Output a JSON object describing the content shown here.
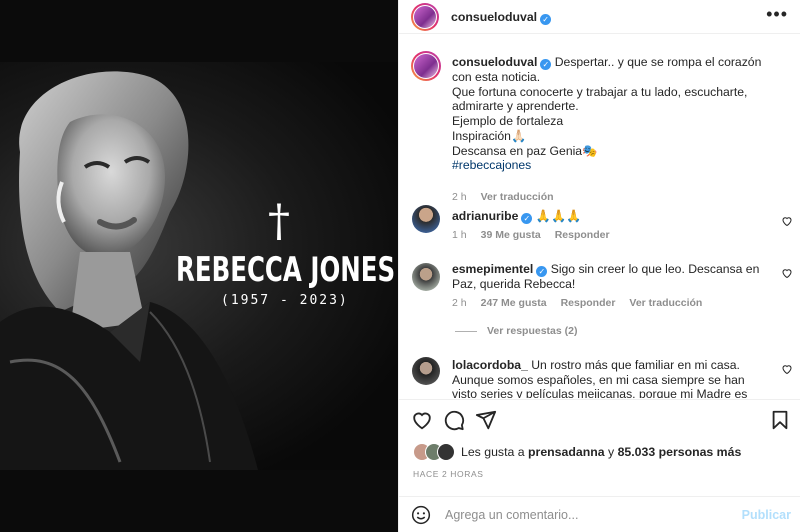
{
  "image": {
    "cross": "†",
    "title": "REBECCA JONES",
    "years": "(1957 - 2023)"
  },
  "header": {
    "username": "consueloduval",
    "verified": "✓",
    "menu": "•••"
  },
  "caption": {
    "username": "consueloduval",
    "verified": "✓",
    "text": "Despertar.. y que se rompa el corazón con esta noticia.",
    "lines": [
      "Que fortuna conocerte y trabajar a tu lado, escucharte, admirarte y aprenderte.",
      "Ejemplo de fortaleza",
      "Inspiración🙏🏻",
      "Descansa en paz Genia🎭"
    ],
    "hashtag": "#rebeccajones",
    "time": "2 h",
    "translate": "Ver traducción"
  },
  "comments": [
    {
      "username": "adrianuribe",
      "verified": "✓",
      "text": "🙏🙏🙏",
      "time": "1 h",
      "likes": "39 Me gusta",
      "reply": "Responder"
    },
    {
      "username": "esmepimentel",
      "verified": "✓",
      "text": "Sigo sin creer lo que leo. Descansa en Paz, querida Rebecca!",
      "time": "2 h",
      "likes": "247 Me gusta",
      "reply": "Responder",
      "translate": "Ver traducción",
      "replies": "Ver respuestas (2)"
    },
    {
      "username": "lolacordoba_",
      "text": "Un rostro más que familiar en mi casa. Aunque somos españoles, en mi casa siempre se han visto series y películas mejicanas, porque mi Madre es una gran"
    }
  ],
  "likes": {
    "prefix": "Les gusta a",
    "user": "prensadanna",
    "middle": "y",
    "count": "85.033 personas más"
  },
  "date": "HACE 2 HORAS",
  "add_comment": {
    "placeholder": "Agrega un comentario...",
    "post": "Publicar"
  },
  "colors": {
    "link": "#00376b",
    "verified": "#3897f0",
    "muted": "#8e8e8e",
    "post_disabled": "#b2dffc"
  }
}
